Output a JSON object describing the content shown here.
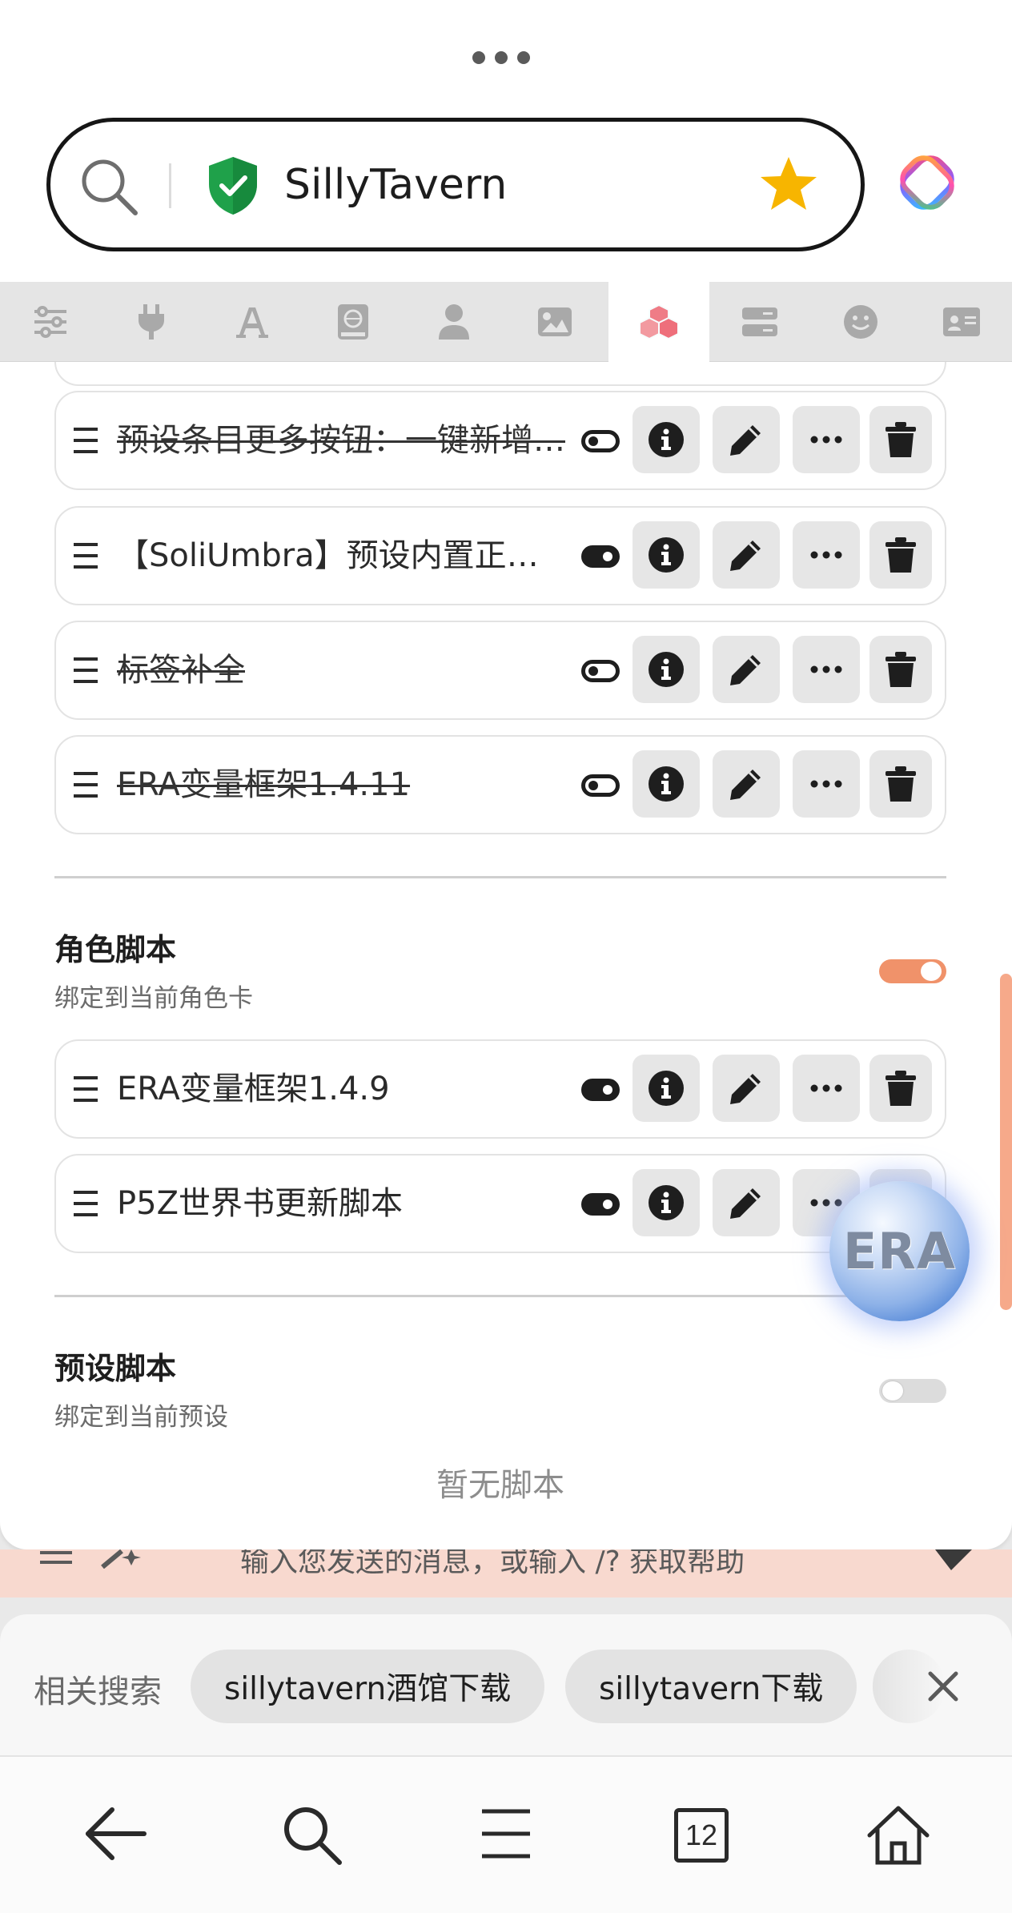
{
  "browser": {
    "site_title": "SillyTavern",
    "menu_dots_icon": "more-dots-icon",
    "ai_app_icon": "ai-app-icon"
  },
  "tabs": [
    {
      "icon": "sliders-icon"
    },
    {
      "icon": "plug-icon"
    },
    {
      "icon": "font-icon"
    },
    {
      "icon": "book-icon"
    },
    {
      "icon": "user-icon"
    },
    {
      "icon": "image-icon"
    },
    {
      "icon": "cubes-icon",
      "active": true
    },
    {
      "icon": "server-icon"
    },
    {
      "icon": "smile-icon"
    },
    {
      "icon": "id-card-icon"
    }
  ],
  "global_scripts": [
    {
      "name": "预设条目更多按钮：一键新增…",
      "enabled": false
    },
    {
      "name": "【SoliUmbra】预设内置正则…",
      "enabled": true
    },
    {
      "name": "标签补全",
      "enabled": false
    },
    {
      "name": "ERA变量框架1.4.11",
      "enabled": false
    }
  ],
  "character_section": {
    "title": "角色脚本",
    "subtitle": "绑定到当前角色卡",
    "enabled": true,
    "scripts": [
      {
        "name": "ERA变量框架1.4.9",
        "enabled": true
      },
      {
        "name": "P5Z世界书更新脚本",
        "enabled": true
      }
    ]
  },
  "preset_section": {
    "title": "预设脚本",
    "subtitle": "绑定到当前预设",
    "enabled": false,
    "empty_text": "暂无脚本"
  },
  "floating_orb": {
    "label": "ERA"
  },
  "chat_input": {
    "placeholder": "输入您发送的消息，或输入 /? 获取帮助"
  },
  "related_search": {
    "label": "相关搜索",
    "chips": [
      "sillytavern酒馆下载",
      "sillytavern下载"
    ]
  },
  "bottom_nav": {
    "tab_count": "12"
  },
  "colors": {
    "accent": "#f0926a",
    "brand_green": "#1fa14a",
    "star": "#f7b500"
  }
}
